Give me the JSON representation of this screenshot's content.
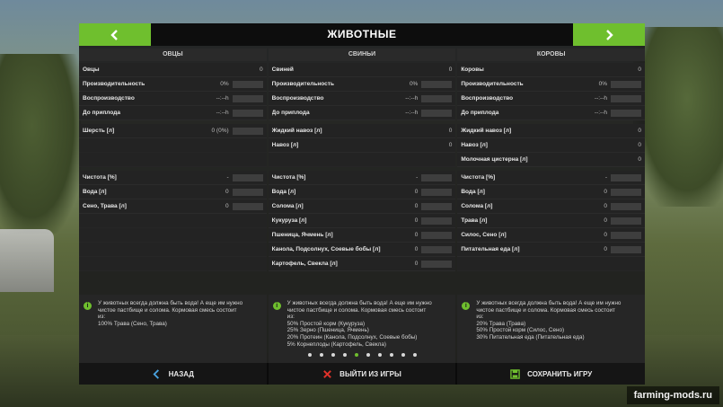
{
  "title": "ЖИВОТНЫЕ",
  "columns": [
    {
      "head": "ОВЦЫ",
      "stats": [
        {
          "label": "Овцы",
          "value": "0",
          "bar": false
        },
        {
          "label": "Производительность",
          "value": "0%",
          "bar": true
        },
        {
          "label": "Воспроизводство",
          "value": "--:--h",
          "bar": true
        },
        {
          "label": "До приплода",
          "value": "--:--h",
          "bar": true
        }
      ],
      "products": [
        {
          "label": "Шерсть [л]",
          "value": "0 (0%)",
          "bar": true
        },
        {
          "label": "",
          "value": "",
          "bar": false
        },
        {
          "label": "",
          "value": "",
          "bar": false
        }
      ],
      "feed": [
        {
          "label": "Чистота [%]",
          "value": "-",
          "bar": true
        },
        {
          "label": "Вода [л]",
          "value": "0",
          "bar": true
        },
        {
          "label": "Сено, Трава [л]",
          "value": "0",
          "bar": true
        },
        {
          "label": "",
          "value": "",
          "bar": false
        },
        {
          "label": "",
          "value": "",
          "bar": false
        },
        {
          "label": "",
          "value": "",
          "bar": false
        },
        {
          "label": "",
          "value": "",
          "bar": false
        }
      ],
      "info": [
        "У животных всегда должна быть вода! А еще им нужно",
        "чистое пастбище и солома. Кормовая смесь состоит",
        "из:",
        "100% Трава (Сено, Трава)"
      ]
    },
    {
      "head": "СВИНЬИ",
      "stats": [
        {
          "label": "Свиней",
          "value": "0",
          "bar": false
        },
        {
          "label": "Производительность",
          "value": "0%",
          "bar": true
        },
        {
          "label": "Воспроизводство",
          "value": "--:--h",
          "bar": true
        },
        {
          "label": "До приплода",
          "value": "--:--h",
          "bar": true
        }
      ],
      "products": [
        {
          "label": "Жидкий навоз [л]",
          "value": "0",
          "bar": false
        },
        {
          "label": "Навоз [л]",
          "value": "0",
          "bar": false
        },
        {
          "label": "",
          "value": "",
          "bar": false
        }
      ],
      "feed": [
        {
          "label": "Чистота [%]",
          "value": "-",
          "bar": true
        },
        {
          "label": "Вода [л]",
          "value": "0",
          "bar": true
        },
        {
          "label": "Солома [л]",
          "value": "0",
          "bar": true
        },
        {
          "label": "Кукуруза [л]",
          "value": "0",
          "bar": true
        },
        {
          "label": "Пшеница, Ячмень [л]",
          "value": "0",
          "bar": true
        },
        {
          "label": "Канола, Подсолнух, Соевые бобы [л]",
          "value": "0",
          "bar": true
        },
        {
          "label": "Картофель, Свекла [л]",
          "value": "0",
          "bar": true
        }
      ],
      "info": [
        "У животных всегда должна быть вода! А еще им нужно",
        "чистое пастбище и солома. Кормовая смесь состоит",
        "из:",
        "50% Простой корм (Кукуруза)",
        "25% Зерно (Пшеница, Ячмень)",
        "20% Протеин (Канола, Подсолнух, Соевые бобы)",
        "5% Корнеплоды (Картофель, Свекла)"
      ]
    },
    {
      "head": "КОРОВЫ",
      "stats": [
        {
          "label": "Коровы",
          "value": "0",
          "bar": false
        },
        {
          "label": "Производительность",
          "value": "0%",
          "bar": true
        },
        {
          "label": "Воспроизводство",
          "value": "--:--h",
          "bar": true
        },
        {
          "label": "До приплода",
          "value": "--:--h",
          "bar": true
        }
      ],
      "products": [
        {
          "label": "Жидкий навоз [л]",
          "value": "0",
          "bar": false
        },
        {
          "label": "Навоз [л]",
          "value": "0",
          "bar": false
        },
        {
          "label": "Молочная цистерна [л]",
          "value": "0",
          "bar": false
        }
      ],
      "feed": [
        {
          "label": "Чистота [%]",
          "value": "-",
          "bar": true
        },
        {
          "label": "Вода [л]",
          "value": "0",
          "bar": true
        },
        {
          "label": "Солома [л]",
          "value": "0",
          "bar": true
        },
        {
          "label": "Трава [л]",
          "value": "0",
          "bar": true
        },
        {
          "label": "Силос, Сено [л]",
          "value": "0",
          "bar": true
        },
        {
          "label": "Питательная еда [л]",
          "value": "0",
          "bar": true
        },
        {
          "label": "",
          "value": "",
          "bar": false
        }
      ],
      "info": [
        "У животных всегда должна быть вода! А еще им нужно",
        "чистое пастбище и солома. Кормовая смесь состоит",
        "из:",
        "20% Трава (Трава)",
        "50% Простой корм (Силос, Сено)",
        "30% Питательная еда (Питательная еда)"
      ]
    }
  ],
  "pagination": {
    "count": 10,
    "active_index": 4
  },
  "footer": {
    "back": "НАЗАД",
    "quit": "ВЫЙТИ ИЗ ИГРЫ",
    "save": "СОХРАНИТЬ ИГРУ"
  },
  "watermark": "farming-mods.ru",
  "colors": {
    "accent": "#6fbf2e",
    "quit_icon": "#e0322a"
  }
}
